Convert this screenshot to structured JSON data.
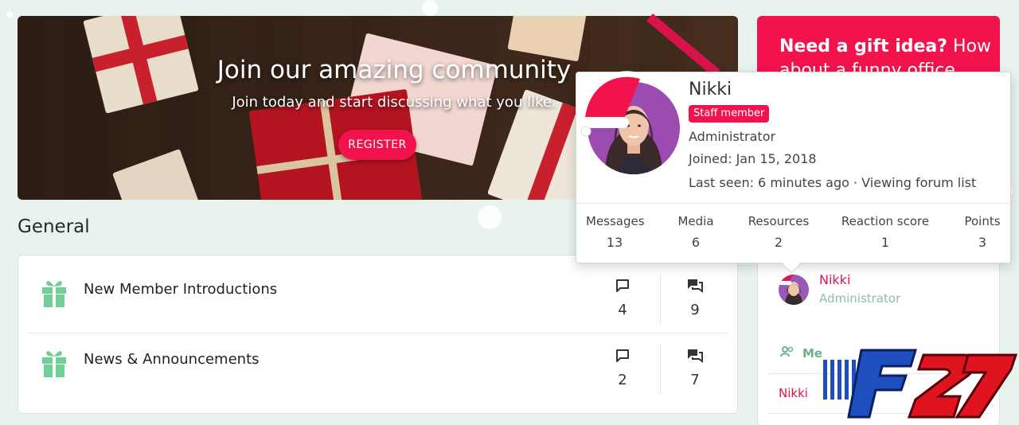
{
  "hero": {
    "title": "Join our amazing community",
    "subtitle": "Join today and start discussing what you like.",
    "register_label": "REGISTER"
  },
  "section": {
    "title": "General"
  },
  "forums": [
    {
      "name": "New Member Introductions",
      "threads": "4",
      "messages": "9",
      "icon": "gift-icon"
    },
    {
      "name": "News & Announcements",
      "threads": "2",
      "messages": "7",
      "icon": "gift-icon"
    }
  ],
  "promo": {
    "bold": "Need a gift idea?",
    "rest": "How about a funny office"
  },
  "staff": {
    "name": "Nikki",
    "role": "Administrator"
  },
  "members": {
    "heading": "Me",
    "member": "Nikki"
  },
  "popup": {
    "name": "Nikki",
    "badge": "Staff member",
    "role": "Administrator",
    "joined": "Joined: Jan 15, 2018",
    "last_seen": "Last seen: 6 minutes ago · Viewing forum list",
    "stats": [
      {
        "label": "Messages",
        "value": "13"
      },
      {
        "label": "Media",
        "value": "6"
      },
      {
        "label": "Resources",
        "value": "2"
      },
      {
        "label": "Reaction score",
        "value": "1"
      },
      {
        "label": "Points",
        "value": "3"
      }
    ]
  },
  "watermark": "F27",
  "colors": {
    "accent": "#f2134d",
    "green": "#6fb08f",
    "background": "#e9f3ee"
  }
}
